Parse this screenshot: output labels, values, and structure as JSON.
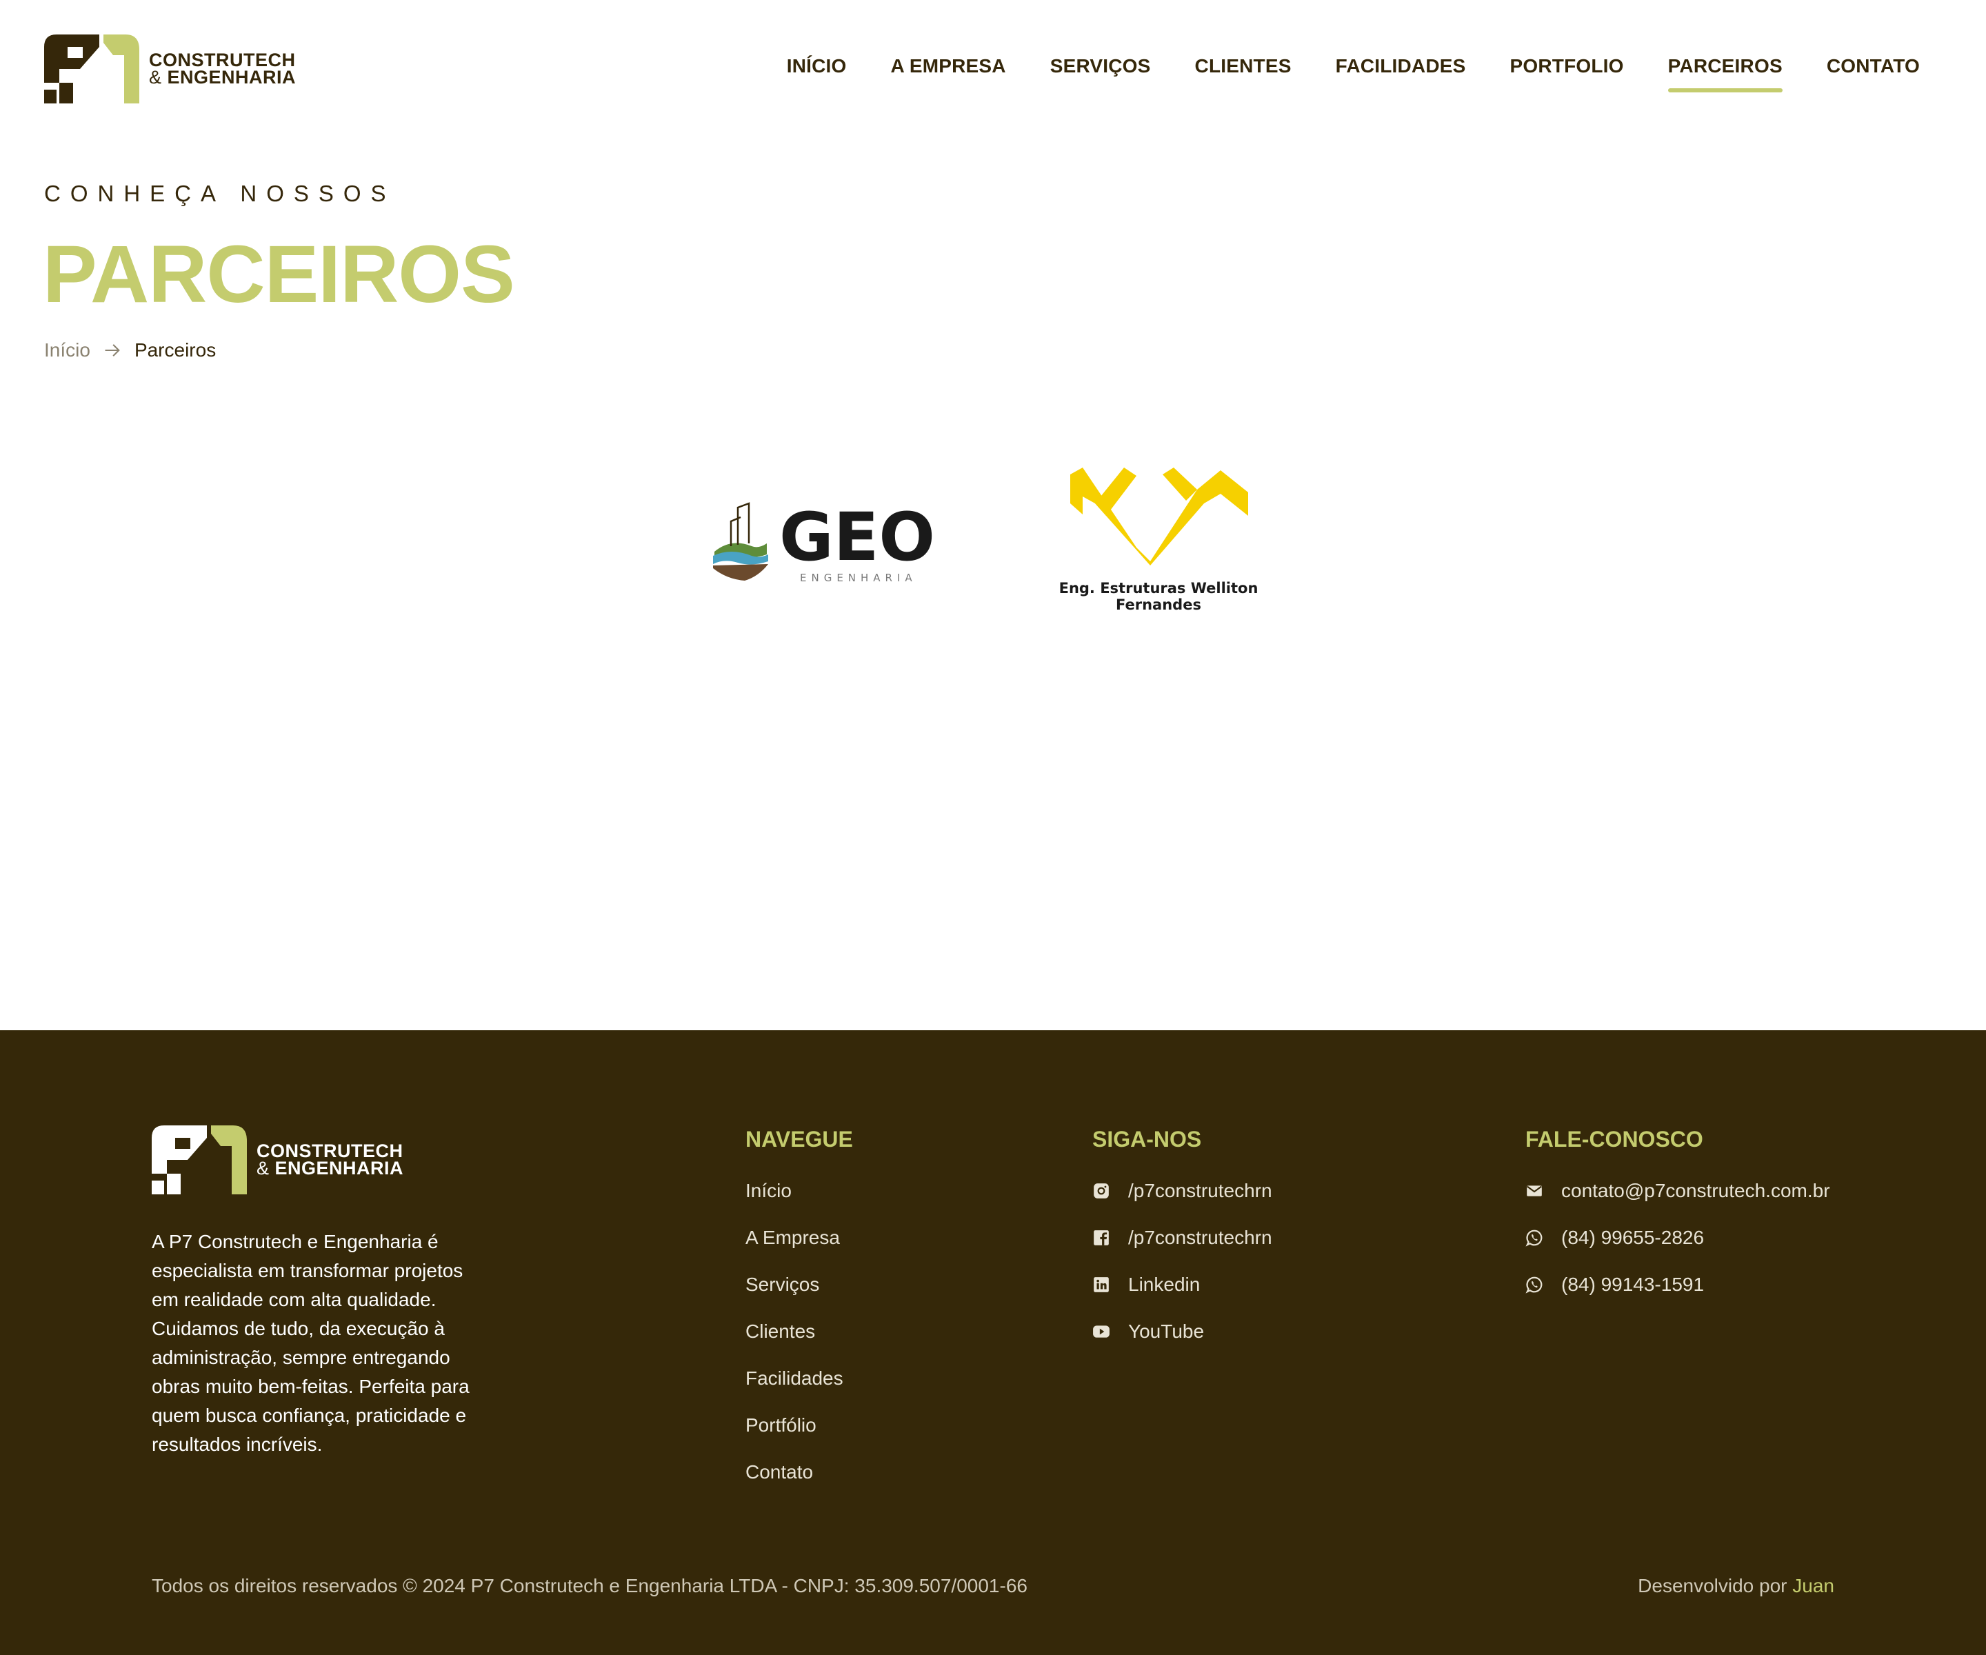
{
  "brand": {
    "line1": "CONSTRUTECH",
    "amp": "&",
    "line2": "ENGENHARIA",
    "accent_color": "#c4cc6e",
    "dark_color": "#35270a"
  },
  "nav": {
    "items": [
      {
        "label": "INÍCIO",
        "active": false
      },
      {
        "label": "A EMPRESA",
        "active": false
      },
      {
        "label": "SERVIÇOS",
        "active": false
      },
      {
        "label": "CLIENTES",
        "active": false
      },
      {
        "label": "FACILIDADES",
        "active": false
      },
      {
        "label": "PORTFOLIO",
        "active": false
      },
      {
        "label": "PARCEIROS",
        "active": true
      },
      {
        "label": "CONTATO",
        "active": false
      }
    ]
  },
  "hero": {
    "kicker": "CONHEÇA NOSSOS",
    "title": "PARCEIROS"
  },
  "breadcrumb": {
    "home": "Início",
    "current": "Parceiros",
    "separator_icon": "arrow-right-icon"
  },
  "partners": [
    {
      "logo_word": "GEO",
      "logo_sub": "ENGENHARIA",
      "icon": "geo-engenharia-logo"
    },
    {
      "caption": "Eng. Estruturas Welliton Fernandes",
      "icon": "welliton-fernandes-logo",
      "color": "#f6d000"
    }
  ],
  "footer": {
    "about": "A P7 Construtech e Engenharia é especialista em transformar projetos em realidade com alta qualidade. Cuidamos de tudo, da execução à administração, sempre entregando obras muito bem-feitas. Perfeita para quem busca confiança, praticidade e resultados incríveis.",
    "nav": {
      "heading": "NAVEGUE",
      "links": [
        "Início",
        "A Empresa",
        "Serviços",
        "Clientes",
        "Facilidades",
        "Portfólio",
        "Contato"
      ]
    },
    "social": {
      "heading": "SIGA-NOS",
      "links": [
        {
          "label": "/p7construtechrn",
          "icon": "instagram-icon"
        },
        {
          "label": "/p7construtechrn",
          "icon": "facebook-icon"
        },
        {
          "label": "Linkedin",
          "icon": "linkedin-icon"
        },
        {
          "label": "YouTube",
          "icon": "youtube-icon"
        }
      ]
    },
    "contact": {
      "heading": "FALE-CONOSCO",
      "items": [
        {
          "label": "contato@p7construtech.com.br",
          "icon": "mail-icon"
        },
        {
          "label": "(84) 99655-2826",
          "icon": "whatsapp-icon"
        },
        {
          "label": "(84) 99143-1591",
          "icon": "whatsapp-icon"
        }
      ]
    },
    "copyright": "Todos os direitos reservados © 2024 P7 Construtech e Engenharia LTDA - CNPJ: 35.309.507/0001-66",
    "dev_prefix": "Desenvolvido por",
    "dev_name": "Juan",
    "background": "#352809"
  }
}
